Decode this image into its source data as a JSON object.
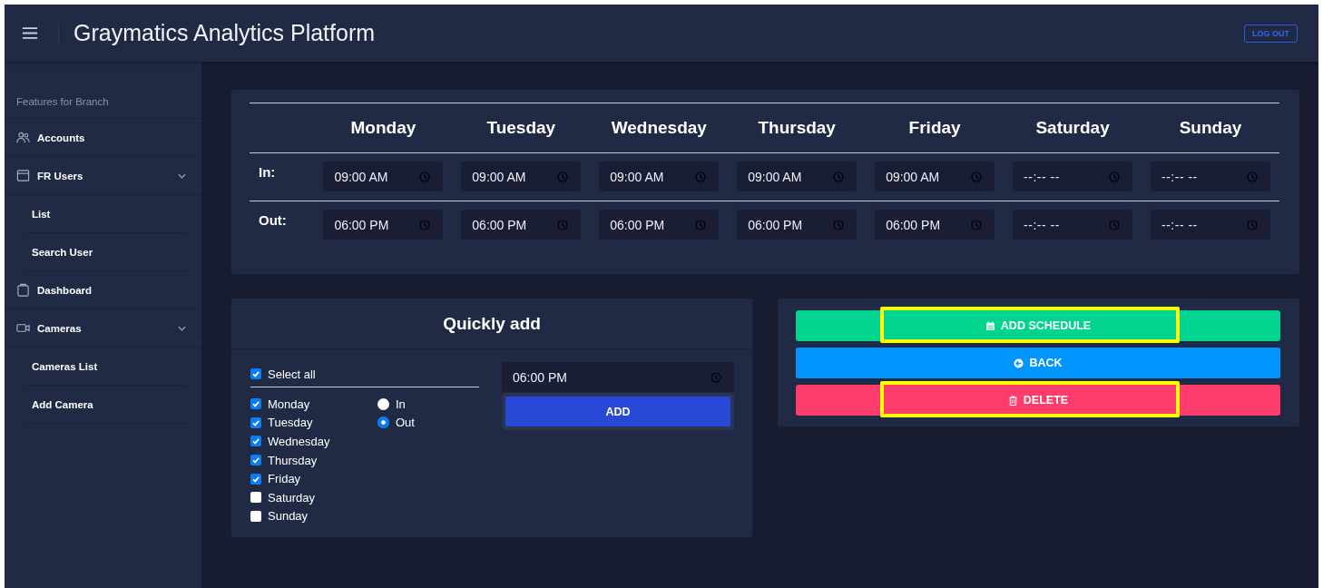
{
  "header": {
    "title": "Graymatics Analytics Platform",
    "logout": "LOG OUT"
  },
  "sidebar": {
    "heading": "Features for Branch",
    "items": [
      {
        "label": "Accounts"
      },
      {
        "label": "FR Users",
        "expanded": true,
        "children": [
          {
            "label": "List"
          },
          {
            "label": "Search User"
          }
        ]
      },
      {
        "label": "Dashboard"
      },
      {
        "label": "Cameras",
        "expanded": true,
        "children": [
          {
            "label": "Cameras List"
          },
          {
            "label": "Add Camera"
          }
        ]
      }
    ]
  },
  "schedule": {
    "days": [
      "Monday",
      "Tuesday",
      "Wednesday",
      "Thursday",
      "Friday",
      "Saturday",
      "Sunday"
    ],
    "rows": [
      {
        "label": "In:",
        "times": [
          {
            "value": "09:00 AM"
          },
          {
            "value": "09:00 AM"
          },
          {
            "value": "09:00 AM"
          },
          {
            "value": "09:00 AM"
          },
          {
            "value": "09:00 AM"
          },
          {
            "placeholder": "--:-- --"
          },
          {
            "placeholder": "--:-- --"
          }
        ]
      },
      {
        "label": "Out:",
        "times": [
          {
            "value": "06:00 PM"
          },
          {
            "value": "06:00 PM"
          },
          {
            "value": "06:00 PM"
          },
          {
            "value": "06:00 PM"
          },
          {
            "value": "06:00 PM"
          },
          {
            "placeholder": "--:-- --"
          },
          {
            "placeholder": "--:-- --"
          }
        ]
      }
    ]
  },
  "quick_add": {
    "title": "Quickly add",
    "select_all": {
      "label": "Select all",
      "checked": true
    },
    "days": [
      {
        "label": "Monday",
        "checked": true
      },
      {
        "label": "Tuesday",
        "checked": true
      },
      {
        "label": "Wednesday",
        "checked": true
      },
      {
        "label": "Thursday",
        "checked": true
      },
      {
        "label": "Friday",
        "checked": true
      },
      {
        "label": "Saturday",
        "checked": false
      },
      {
        "label": "Sunday",
        "checked": false
      }
    ],
    "modes": [
      {
        "label": "In",
        "selected": false
      },
      {
        "label": "Out",
        "selected": true
      }
    ],
    "time": {
      "value": "06:00 PM"
    },
    "add_button": "ADD"
  },
  "actions": [
    {
      "label": "ADD SCHEDULE",
      "kind": "add",
      "highlighted": true
    },
    {
      "label": "BACK",
      "kind": "back",
      "highlighted": false
    },
    {
      "label": "DELETE",
      "kind": "delete",
      "highlighted": true
    }
  ]
}
